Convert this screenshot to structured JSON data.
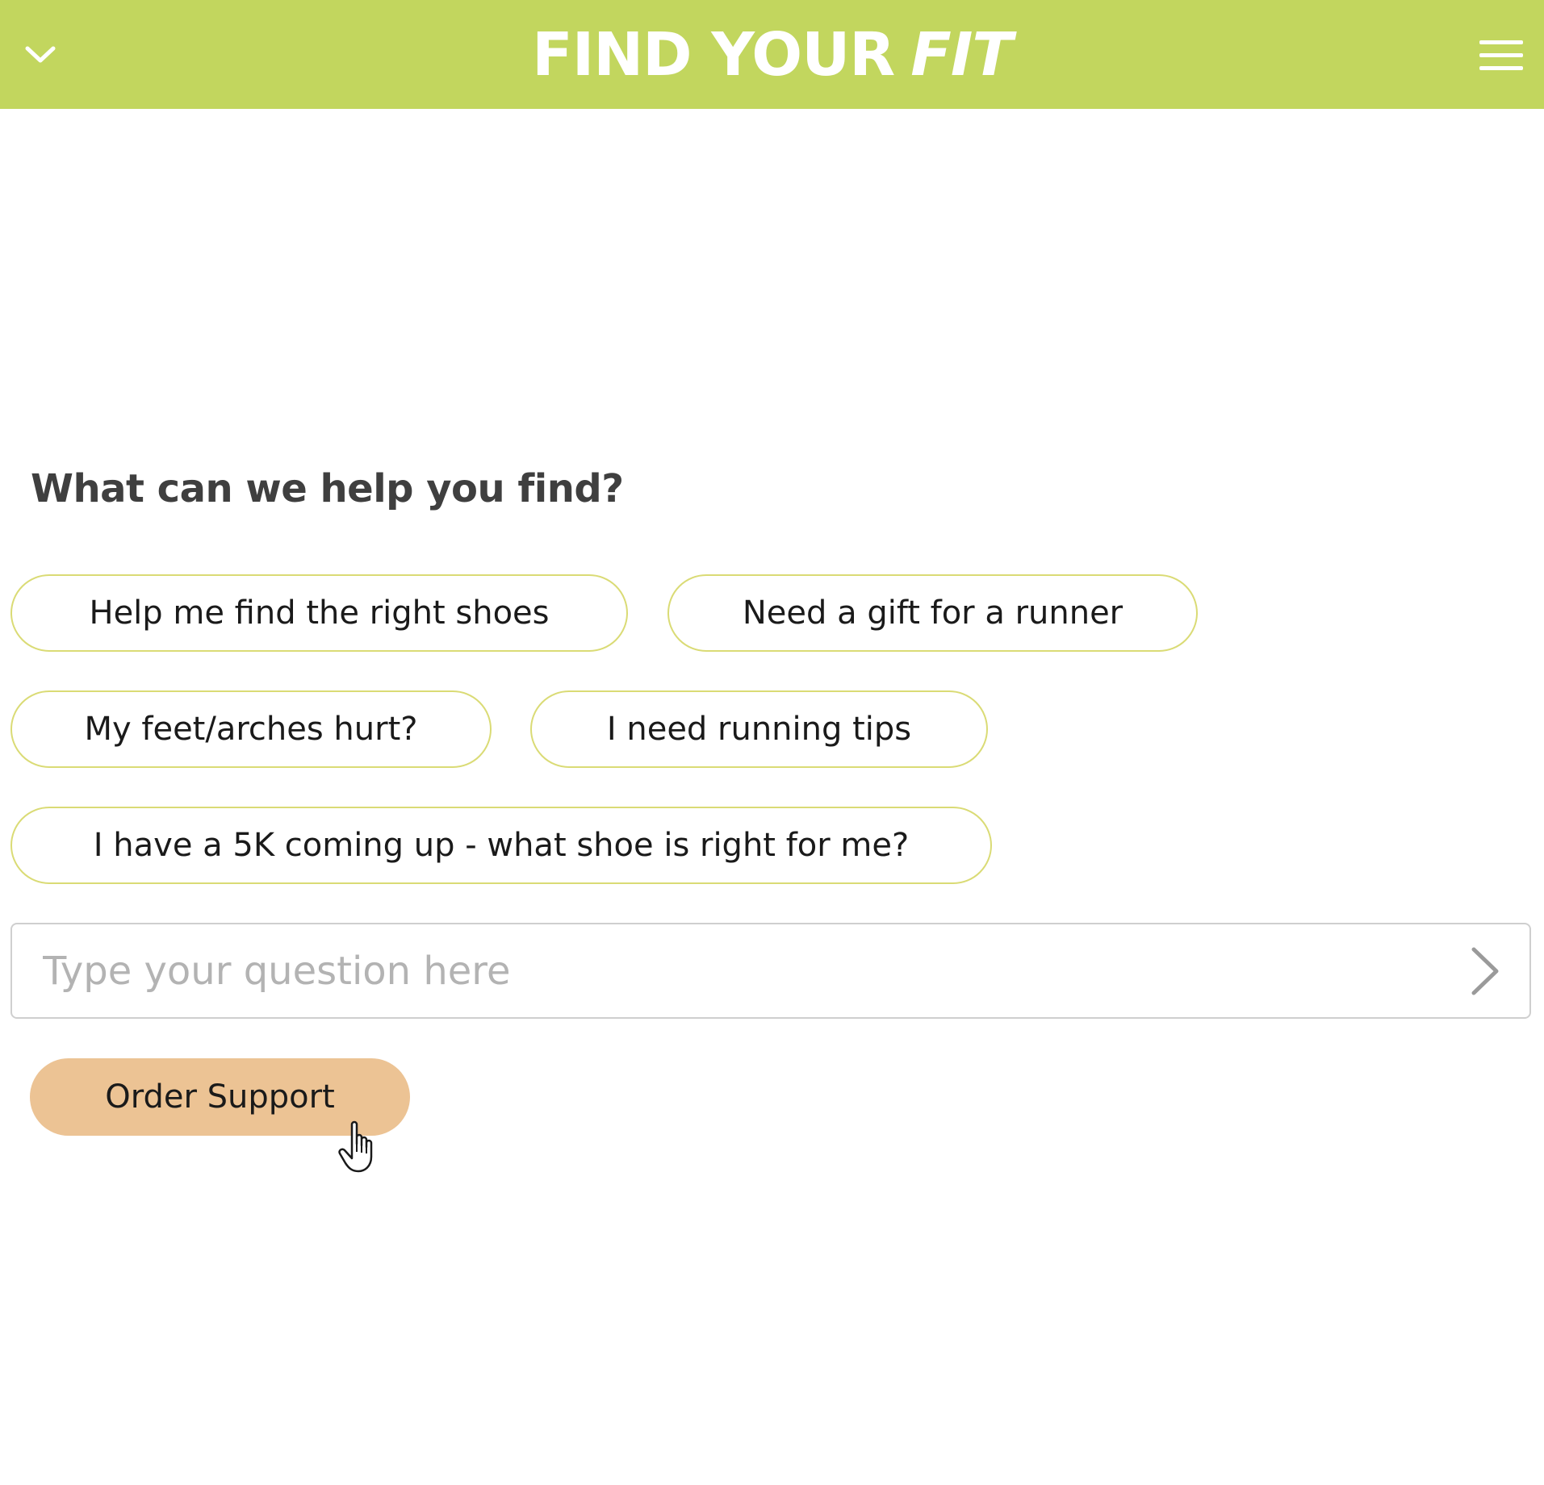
{
  "header": {
    "title_main": "FIND YOUR",
    "title_accent": "FIT",
    "collapse_icon": "chevron-down-icon",
    "menu_icon": "hamburger-menu-icon"
  },
  "prompt": "What can we help you find?",
  "suggestions": [
    "Help me find the right shoes",
    "Need a gift for a runner",
    "My feet/arches hurt?",
    "I need running tips",
    "I have a 5K coming up - what shoe is right for me?"
  ],
  "question": {
    "value": "",
    "placeholder": "Type your question here",
    "send_icon": "chevron-right-icon"
  },
  "support_button": "Order Support",
  "cursor_icon": "hand-pointer-icon",
  "colors": {
    "header_bg": "#c2d65e",
    "chip_border": "#dadb75",
    "support_bg": "#ecc394",
    "prompt_text": "#3f3f3f"
  }
}
